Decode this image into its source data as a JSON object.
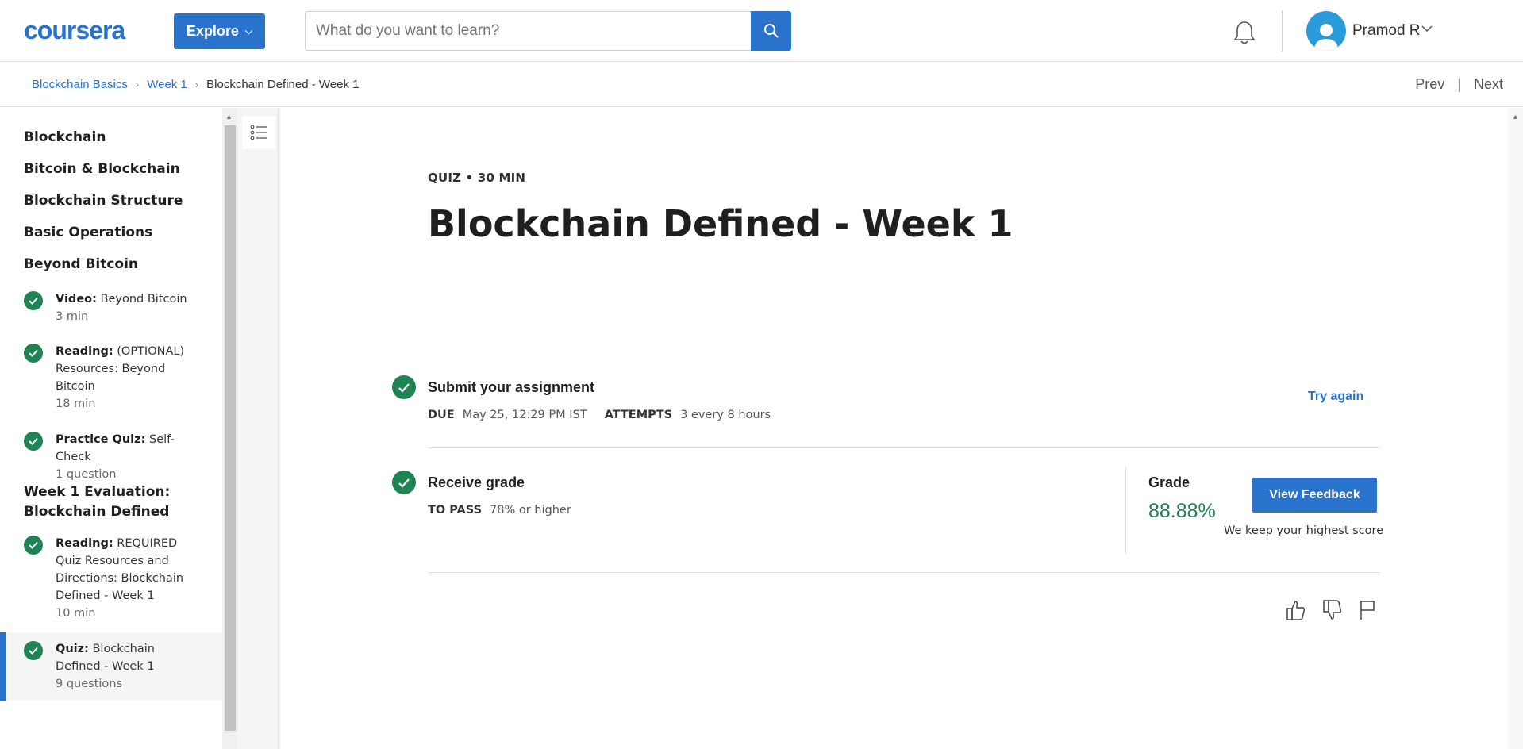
{
  "header": {
    "logo": "coursera",
    "explore_label": "Explore",
    "search_placeholder": "What do you want to learn?",
    "user_name": "Pramod R"
  },
  "breadcrumb": {
    "items": [
      "Blockchain Basics",
      "Week 1",
      "Blockchain Defined - Week 1"
    ],
    "prev": "Prev",
    "next": "Next"
  },
  "sidebar": {
    "lessons": [
      "Blockchain",
      "Bitcoin & Blockchain",
      "Blockchain Structure",
      "Basic Operations",
      "Beyond Bitcoin"
    ],
    "items_beyond": [
      {
        "type": "Video:",
        "title": " Beyond Bitcoin",
        "duration": "3 min"
      },
      {
        "type": "Reading:",
        "title": " (OPTIONAL) Resources: Beyond Bitcoin",
        "duration": "18 min"
      },
      {
        "type": "Practice Quiz:",
        "title": " Self-Check",
        "duration": "1 question"
      }
    ],
    "week_eval_title": "Week 1 Evaluation: Blockchain Defined",
    "items_eval": [
      {
        "type": "Reading:",
        "title": " REQUIRED Quiz Resources and Directions: Blockchain Defined - Week 1",
        "duration": "10 min"
      },
      {
        "type": "Quiz:",
        "title": " Blockchain Defined - Week 1",
        "duration": "9 questions"
      }
    ]
  },
  "main": {
    "meta": "QUIZ • 30 MIN",
    "title": "Blockchain Defined - Week 1",
    "submit": {
      "title": "Submit your assignment",
      "due_key": "DUE",
      "due_value": "May 25, 12:29 PM IST",
      "attempts_key": "ATTEMPTS",
      "attempts_value": "3 every 8 hours",
      "action": "Try again"
    },
    "receive": {
      "title": "Receive grade",
      "pass_key": "TO PASS",
      "pass_value": "78% or higher",
      "grade_label": "Grade",
      "grade_value": "88.88%",
      "feedback_label": "View Feedback",
      "note": "We keep your highest score"
    }
  },
  "colors": {
    "accent": "#2a73cc",
    "success": "#1f8354"
  }
}
